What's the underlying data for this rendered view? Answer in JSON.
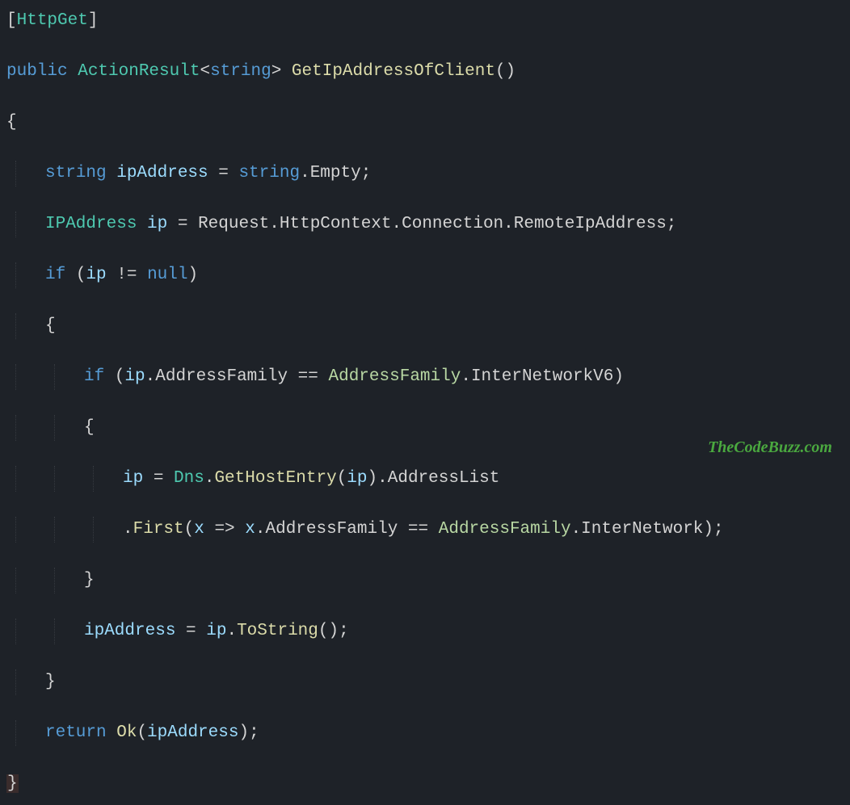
{
  "code": {
    "lines": [
      {
        "indent": 0,
        "tokens": [
          {
            "t": "[",
            "c": "tok-brackets"
          },
          {
            "t": "HttpGet",
            "c": "tok-attr"
          },
          {
            "t": "]",
            "c": "tok-brackets"
          }
        ]
      },
      {
        "indent": 0,
        "tokens": [
          {
            "t": "public ",
            "c": "tok-kw"
          },
          {
            "t": "ActionResult",
            "c": "tok-type"
          },
          {
            "t": "<",
            "c": "tok-punc"
          },
          {
            "t": "string",
            "c": "tok-string"
          },
          {
            "t": "> ",
            "c": "tok-punc"
          },
          {
            "t": "GetIpAddressOfClient",
            "c": "tok-method"
          },
          {
            "t": "()",
            "c": "tok-punc"
          }
        ]
      },
      {
        "indent": 0,
        "tokens": [
          {
            "t": "{",
            "c": "tok-punc"
          }
        ]
      },
      {
        "indent": 1,
        "tokens": [
          {
            "t": "string ",
            "c": "tok-kw"
          },
          {
            "t": "ipAddress",
            "c": "tok-var"
          },
          {
            "t": " = ",
            "c": "tok-punc"
          },
          {
            "t": "string",
            "c": "tok-kw"
          },
          {
            "t": ".",
            "c": "tok-punc"
          },
          {
            "t": "Empty",
            "c": "tok-prop"
          },
          {
            "t": ";",
            "c": "tok-punc"
          }
        ]
      },
      {
        "indent": 1,
        "tokens": [
          {
            "t": "IPAddress ",
            "c": "tok-type"
          },
          {
            "t": "ip",
            "c": "tok-var"
          },
          {
            "t": " = ",
            "c": "tok-punc"
          },
          {
            "t": "Request",
            "c": "tok-prop"
          },
          {
            "t": ".",
            "c": "tok-punc"
          },
          {
            "t": "HttpContext",
            "c": "tok-prop"
          },
          {
            "t": ".",
            "c": "tok-punc"
          },
          {
            "t": "Connection",
            "c": "tok-prop"
          },
          {
            "t": ".",
            "c": "tok-punc"
          },
          {
            "t": "RemoteIpAddress",
            "c": "tok-prop"
          },
          {
            "t": ";",
            "c": "tok-punc"
          }
        ]
      },
      {
        "indent": 1,
        "tokens": [
          {
            "t": "if ",
            "c": "tok-kw"
          },
          {
            "t": "(",
            "c": "tok-punc"
          },
          {
            "t": "ip",
            "c": "tok-var"
          },
          {
            "t": " != ",
            "c": "tok-punc"
          },
          {
            "t": "null",
            "c": "tok-kw"
          },
          {
            "t": ")",
            "c": "tok-punc"
          }
        ]
      },
      {
        "indent": 1,
        "tokens": [
          {
            "t": "{",
            "c": "tok-punc"
          }
        ]
      },
      {
        "indent": 2,
        "tokens": [
          {
            "t": "if ",
            "c": "tok-kw"
          },
          {
            "t": "(",
            "c": "tok-punc"
          },
          {
            "t": "ip",
            "c": "tok-var"
          },
          {
            "t": ".",
            "c": "tok-punc"
          },
          {
            "t": "AddressFamily",
            "c": "tok-prop"
          },
          {
            "t": " == ",
            "c": "tok-punc"
          },
          {
            "t": "AddressFamily",
            "c": "tok-enum"
          },
          {
            "t": ".",
            "c": "tok-punc"
          },
          {
            "t": "InterNetworkV6",
            "c": "tok-prop"
          },
          {
            "t": ")",
            "c": "tok-punc"
          }
        ]
      },
      {
        "indent": 2,
        "tokens": [
          {
            "t": "{",
            "c": "tok-punc"
          }
        ]
      },
      {
        "indent": 3,
        "tokens": [
          {
            "t": "ip",
            "c": "tok-var"
          },
          {
            "t": " = ",
            "c": "tok-punc"
          },
          {
            "t": "Dns",
            "c": "tok-type"
          },
          {
            "t": ".",
            "c": "tok-punc"
          },
          {
            "t": "GetHostEntry",
            "c": "tok-method"
          },
          {
            "t": "(",
            "c": "tok-punc"
          },
          {
            "t": "ip",
            "c": "tok-var"
          },
          {
            "t": ")",
            "c": "tok-punc"
          },
          {
            "t": ".",
            "c": "tok-punc"
          },
          {
            "t": "AddressList",
            "c": "tok-prop"
          }
        ]
      },
      {
        "indent": 3,
        "tokens": [
          {
            "t": ".",
            "c": "tok-punc"
          },
          {
            "t": "First",
            "c": "tok-method"
          },
          {
            "t": "(",
            "c": "tok-punc"
          },
          {
            "t": "x",
            "c": "tok-param"
          },
          {
            "t": " => ",
            "c": "tok-punc"
          },
          {
            "t": "x",
            "c": "tok-param"
          },
          {
            "t": ".",
            "c": "tok-punc"
          },
          {
            "t": "AddressFamily",
            "c": "tok-prop"
          },
          {
            "t": " == ",
            "c": "tok-punc"
          },
          {
            "t": "AddressFamily",
            "c": "tok-enum"
          },
          {
            "t": ".",
            "c": "tok-punc"
          },
          {
            "t": "InterNetwork",
            "c": "tok-prop"
          },
          {
            "t": ");",
            "c": "tok-punc"
          }
        ]
      },
      {
        "indent": 2,
        "tokens": [
          {
            "t": "}",
            "c": "tok-punc"
          }
        ]
      },
      {
        "indent": 2,
        "tokens": [
          {
            "t": "ipAddress",
            "c": "tok-var"
          },
          {
            "t": " = ",
            "c": "tok-punc"
          },
          {
            "t": "ip",
            "c": "tok-var"
          },
          {
            "t": ".",
            "c": "tok-punc"
          },
          {
            "t": "ToString",
            "c": "tok-method"
          },
          {
            "t": "();",
            "c": "tok-punc"
          }
        ]
      },
      {
        "indent": 1,
        "tokens": [
          {
            "t": "}",
            "c": "tok-punc"
          }
        ]
      },
      {
        "indent": 1,
        "tokens": [
          {
            "t": "return ",
            "c": "tok-kw"
          },
          {
            "t": "Ok",
            "c": "tok-method"
          },
          {
            "t": "(",
            "c": "tok-punc"
          },
          {
            "t": "ipAddress",
            "c": "tok-var"
          },
          {
            "t": ");",
            "c": "tok-punc"
          }
        ]
      },
      {
        "indent": 0,
        "last": true,
        "tokens": [
          {
            "t": "}",
            "c": "close-brace-hl"
          }
        ]
      }
    ]
  },
  "watermark": "TheCodeBuzz.com",
  "colors": {
    "background": "#1e2228",
    "keyword": "#569cd6",
    "type": "#4ec9b0",
    "method": "#dcdcaa",
    "variable": "#9cdcfe",
    "default": "#d4d4d4",
    "watermark": "#4aa83f"
  }
}
